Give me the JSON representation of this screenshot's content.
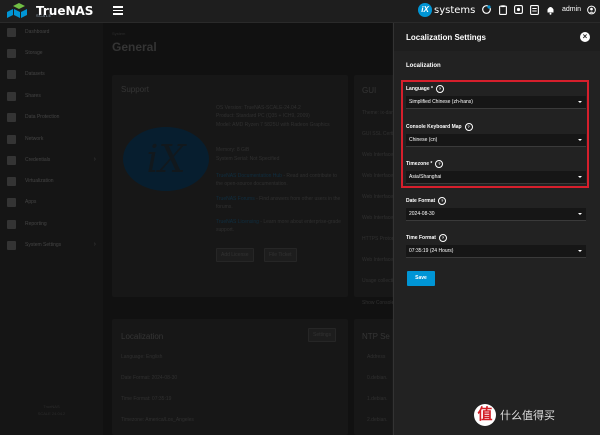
{
  "topbar": {
    "brand": "TrueNAS",
    "brand_sub": "SCALE",
    "ix_mark": "iX",
    "ix_text": "systems",
    "user": "admin",
    "icons": [
      "truecommand-icon",
      "clipboard-icon",
      "settings-gear-icon",
      "tasks-icon",
      "bell-icon",
      "account-icon",
      "power-icon"
    ]
  },
  "sidebar": {
    "items": [
      {
        "label": "Dashboard",
        "icon": "dashboard-icon"
      },
      {
        "label": "Storage",
        "icon": "storage-icon"
      },
      {
        "label": "Datasets",
        "icon": "datasets-icon"
      },
      {
        "label": "Shares",
        "icon": "shares-icon"
      },
      {
        "label": "Data Protection",
        "icon": "shield-icon"
      },
      {
        "label": "Network",
        "icon": "network-icon"
      },
      {
        "label": "Credentials",
        "icon": "key-icon"
      },
      {
        "label": "Virtualization",
        "icon": "monitor-icon"
      },
      {
        "label": "Apps",
        "icon": "apps-icon"
      },
      {
        "label": "Reporting",
        "icon": "chart-icon"
      },
      {
        "label": "System Settings",
        "icon": "gear-icon"
      }
    ],
    "footer_line1": "TrueNAS",
    "footer_line2": "SCALE 24.04.2"
  },
  "main": {
    "breadcrumb": "System",
    "title": "General",
    "support": {
      "title": "Support",
      "os_version": "OS Version:  TrueNAS-SCALE-24.04.2",
      "product": "Product:  Standard PC (Q35 + ICH9, 2009)",
      "model": "Model:  AMD Ryzen 7 5825U with Radeon Graphics",
      "memory": "Memory:  8 GiB",
      "serial": "System Serial:  Not Specified",
      "doc_link": "TrueNAS Documentation Hub",
      "doc_text": "- Read and contribute to the open-source documentation.",
      "forums_link": "TrueNAS Forums",
      "forums_text": "- Find answers from other users in the forums.",
      "licensing_link": "TrueNAS Licensing",
      "licensing_text": "- Learn more about enterprise-grade support.",
      "add_license": "Add License",
      "file_ticket": "File Ticket"
    },
    "gui": {
      "title": "GUI",
      "rows": [
        "Theme:  ix-dark",
        "GUI SSL Certificate",
        "Web Interface",
        "Web Interface",
        "Web Interface",
        "Web Interface",
        "HTTPS Protocols",
        "Web Interface",
        "Usage collection",
        "Show Console"
      ]
    },
    "localization": {
      "title": "Localization",
      "settings_button": "Settings",
      "language": "Language:  English",
      "date_format": "Date Format:  2024-08-30",
      "time_format": "Time Format:  07:35:19",
      "timezone": "Timezone:  America/Los_Angeles"
    },
    "ntp": {
      "title": "NTP Se",
      "address_header": "Address",
      "servers": [
        "0.debian.",
        "1.debian.",
        "2.debian."
      ]
    }
  },
  "panel": {
    "title": "Localization Settings",
    "section": "Localization",
    "language_label": "Language *",
    "language_value": "Simplified Chinese (zh-hans)",
    "keyboard_label": "Console Keyboard Map",
    "keyboard_value": "Chinese (cn)",
    "timezone_label": "Timezone *",
    "timezone_value": "Asia/Shanghai",
    "date_label": "Date Format",
    "date_value": "2024-08-30",
    "time_label": "Time Format",
    "time_value": "07:35:19 (24 Hours)",
    "save": "Save"
  },
  "watermark": {
    "mark": "值",
    "text": "什么值得买"
  },
  "colors": {
    "accent": "#0095d5",
    "highlight": "#d61f2c"
  }
}
